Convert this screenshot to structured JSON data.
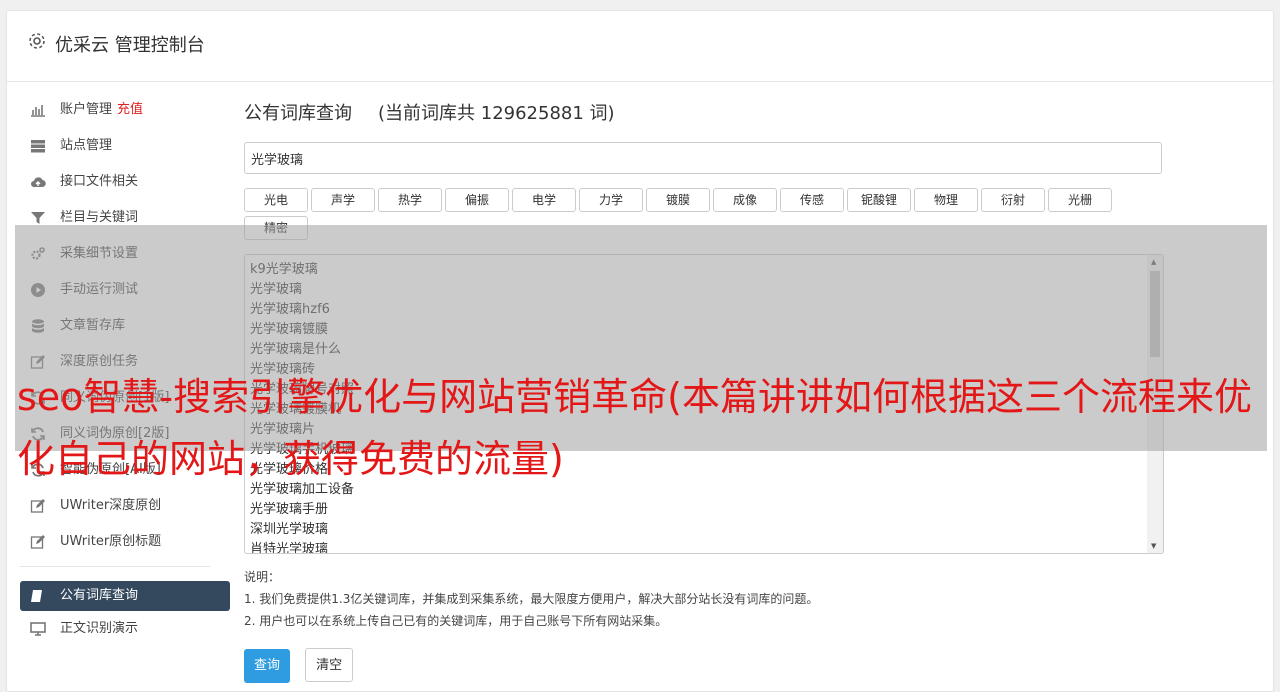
{
  "app": {
    "title": "优采云 管理控制台",
    "icon": "gear-icon"
  },
  "sidebar": {
    "items": [
      {
        "label": "账户管理",
        "extra": "充值",
        "icon": "bar-chart-icon"
      },
      {
        "label": "站点管理",
        "icon": "server-icon"
      },
      {
        "label": "接口文件相关",
        "icon": "cloud-upload-icon"
      },
      {
        "label": "栏目与关键词",
        "icon": "filter-icon"
      },
      {
        "label": "采集细节设置",
        "icon": "cogs-icon"
      },
      {
        "label": "手动运行测试",
        "icon": "play-icon"
      },
      {
        "label": "文章暂存库",
        "icon": "database-icon"
      },
      {
        "label": "深度原创任务",
        "icon": "edit-icon"
      },
      {
        "label": "同义词伪原创[1版]",
        "icon": "refresh-icon"
      },
      {
        "label": "同义词伪原创[2版]",
        "icon": "refresh-icon"
      },
      {
        "label": "智能伪原创[AI版]",
        "icon": "refresh-icon"
      },
      {
        "label": "UWriter深度原创",
        "icon": "edit-icon"
      },
      {
        "label": "UWriter原创标题",
        "icon": "edit-icon"
      }
    ],
    "active_item": {
      "label": "公有词库查询",
      "icon": "book-icon"
    },
    "after_items": [
      {
        "label": "正文识别演示",
        "icon": "monitor-icon"
      }
    ]
  },
  "main": {
    "heading": "公有词库查询",
    "count_text": "(当前词库共 129625881 词)",
    "search_value": "光学玻璃",
    "tags": [
      "光电",
      "声学",
      "热学",
      "偏振",
      "电学",
      "力学",
      "镀膜",
      "成像",
      "传感",
      "铌酸锂",
      "物理",
      "衍射",
      "光栅",
      "精密"
    ],
    "results": [
      "k9光学玻璃",
      "光学玻璃",
      "光学玻璃hzf6",
      "光学玻璃镀膜",
      "光学玻璃是什么",
      "光学玻璃砖",
      "光学玻璃牌号对照",
      "光学玻璃镀膜机",
      "光学玻璃片",
      "光学玻璃手机玻璃",
      "光学玻璃价格",
      "光学玻璃加工设备",
      "光学玻璃手册",
      "深圳光学玻璃",
      "肖特光学玻璃"
    ],
    "notes_title": "说明：",
    "notes": [
      "1. 我们免费提供1.3亿关键词库，并集成到采集系统，最大限度方便用户，解决大部分站长没有词库的问题。",
      "2. 用户也可以在系统上传自己已有的关键词库，用于自己账号下所有网站采集。"
    ],
    "query_button": "查询",
    "clear_button": "清空"
  },
  "overlay": {
    "text": "seo智慧-搜索引擎优化与网站营销革命(本篇讲讲如何根据这三个流程来优化自己的网站，获得免费的流量)"
  }
}
